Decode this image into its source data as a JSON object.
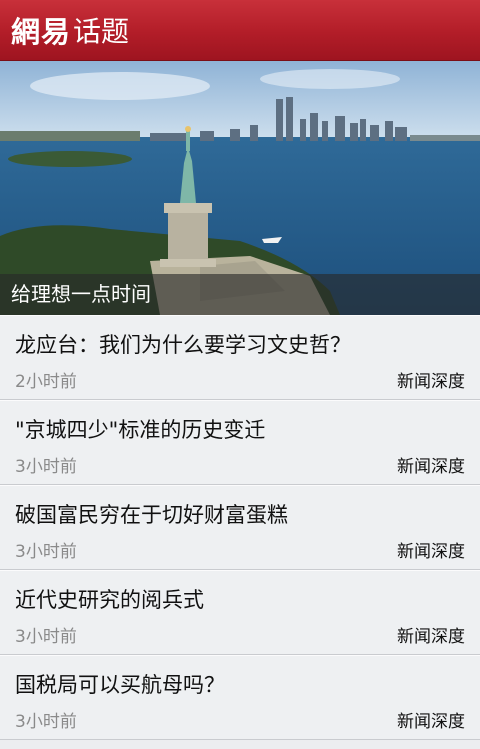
{
  "header": {
    "brand": "網易",
    "title": "话题"
  },
  "hero": {
    "caption": "给理想一点时间"
  },
  "articles": [
    {
      "title": "龙应台：我们为什么要学习文史哲？",
      "time": "2小时前",
      "source": "新闻深度"
    },
    {
      "title": "\"京城四少\"标准的历史变迁",
      "time": "3小时前",
      "source": "新闻深度"
    },
    {
      "title": "破国富民穷在于切好财富蛋糕",
      "time": "3小时前",
      "source": "新闻深度"
    },
    {
      "title": "近代史研究的阅兵式",
      "time": "3小时前",
      "source": "新闻深度"
    },
    {
      "title": "国税局可以买航母吗？",
      "time": "3小时前",
      "source": "新闻深度"
    }
  ],
  "colors": {
    "header": "#b21d28",
    "background": "#ecedf0"
  }
}
